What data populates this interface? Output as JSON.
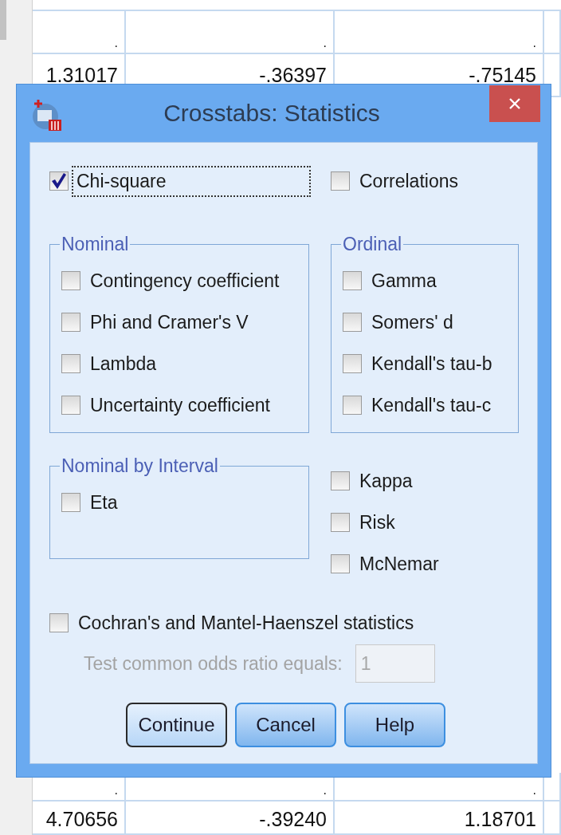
{
  "sheet": {
    "top_rows": [
      {
        "cells": [
          ".",
          ".",
          "."
        ]
      },
      {
        "cells": [
          "1.31017",
          "-.36397",
          "-.75145"
        ]
      }
    ],
    "bottom_rows": [
      {
        "cells": [
          ".",
          ".",
          "."
        ]
      },
      {
        "cells": [
          "4.70656",
          "-.39240",
          "1.18701"
        ]
      }
    ]
  },
  "dialog": {
    "title": "Crosstabs: Statistics",
    "top_options": [
      {
        "label": "Chi-square",
        "checked": true,
        "focused": true
      },
      {
        "label": "Correlations",
        "checked": false,
        "focused": false
      }
    ],
    "groups": [
      {
        "legend": "Nominal",
        "options": [
          {
            "label": "Contingency coefficient",
            "checked": false
          },
          {
            "label": "Phi and Cramer's V",
            "checked": false
          },
          {
            "label": "Lambda",
            "checked": false
          },
          {
            "label": "Uncertainty coefficient",
            "checked": false
          }
        ]
      },
      {
        "legend": "Ordinal",
        "options": [
          {
            "label": "Gamma",
            "checked": false
          },
          {
            "label": "Somers' d",
            "checked": false
          },
          {
            "label": "Kendall's tau-b",
            "checked": false
          },
          {
            "label": "Kendall's tau-c",
            "checked": false
          }
        ]
      },
      {
        "legend": "Nominal by Interval",
        "options": [
          {
            "label": "Eta",
            "checked": false
          }
        ]
      }
    ],
    "other_options": [
      {
        "label": "Kappa",
        "checked": false
      },
      {
        "label": "Risk",
        "checked": false
      },
      {
        "label": "McNemar",
        "checked": false
      }
    ],
    "cochran": {
      "label": "Cochran's and Mantel-Haenszel statistics",
      "checked": false
    },
    "odds_ratio": {
      "label": "Test common odds ratio equals:",
      "value": "1",
      "disabled": true
    },
    "buttons": [
      {
        "label": "Continue",
        "default": true
      },
      {
        "label": "Cancel",
        "default": false
      },
      {
        "label": "Help",
        "default": false
      }
    ]
  }
}
